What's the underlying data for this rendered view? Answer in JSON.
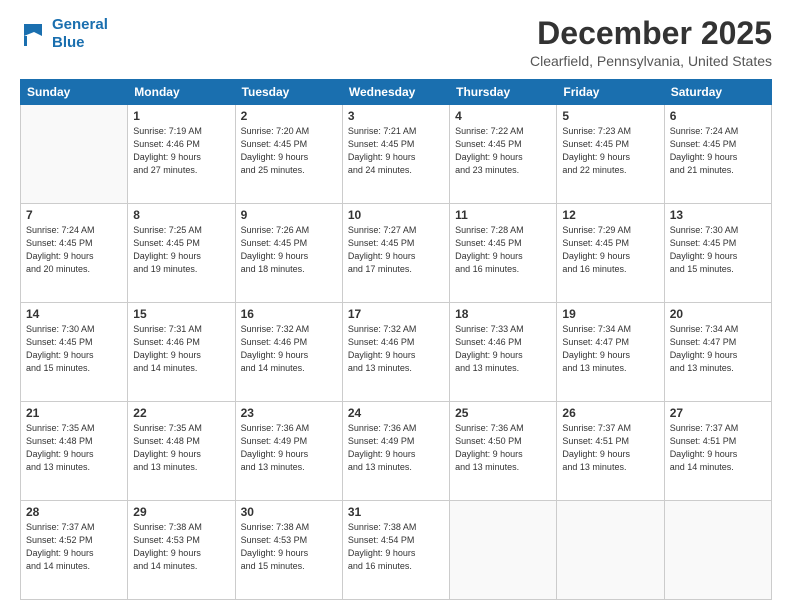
{
  "header": {
    "logo_line1": "General",
    "logo_line2": "Blue",
    "month_title": "December 2025",
    "location": "Clearfield, Pennsylvania, United States"
  },
  "weekdays": [
    "Sunday",
    "Monday",
    "Tuesday",
    "Wednesday",
    "Thursday",
    "Friday",
    "Saturday"
  ],
  "weeks": [
    [
      {
        "day": "",
        "info": ""
      },
      {
        "day": "1",
        "info": "Sunrise: 7:19 AM\nSunset: 4:46 PM\nDaylight: 9 hours\nand 27 minutes."
      },
      {
        "day": "2",
        "info": "Sunrise: 7:20 AM\nSunset: 4:45 PM\nDaylight: 9 hours\nand 25 minutes."
      },
      {
        "day": "3",
        "info": "Sunrise: 7:21 AM\nSunset: 4:45 PM\nDaylight: 9 hours\nand 24 minutes."
      },
      {
        "day": "4",
        "info": "Sunrise: 7:22 AM\nSunset: 4:45 PM\nDaylight: 9 hours\nand 23 minutes."
      },
      {
        "day": "5",
        "info": "Sunrise: 7:23 AM\nSunset: 4:45 PM\nDaylight: 9 hours\nand 22 minutes."
      },
      {
        "day": "6",
        "info": "Sunrise: 7:24 AM\nSunset: 4:45 PM\nDaylight: 9 hours\nand 21 minutes."
      }
    ],
    [
      {
        "day": "7",
        "info": "Sunrise: 7:24 AM\nSunset: 4:45 PM\nDaylight: 9 hours\nand 20 minutes."
      },
      {
        "day": "8",
        "info": "Sunrise: 7:25 AM\nSunset: 4:45 PM\nDaylight: 9 hours\nand 19 minutes."
      },
      {
        "day": "9",
        "info": "Sunrise: 7:26 AM\nSunset: 4:45 PM\nDaylight: 9 hours\nand 18 minutes."
      },
      {
        "day": "10",
        "info": "Sunrise: 7:27 AM\nSunset: 4:45 PM\nDaylight: 9 hours\nand 17 minutes."
      },
      {
        "day": "11",
        "info": "Sunrise: 7:28 AM\nSunset: 4:45 PM\nDaylight: 9 hours\nand 16 minutes."
      },
      {
        "day": "12",
        "info": "Sunrise: 7:29 AM\nSunset: 4:45 PM\nDaylight: 9 hours\nand 16 minutes."
      },
      {
        "day": "13",
        "info": "Sunrise: 7:30 AM\nSunset: 4:45 PM\nDaylight: 9 hours\nand 15 minutes."
      }
    ],
    [
      {
        "day": "14",
        "info": "Sunrise: 7:30 AM\nSunset: 4:45 PM\nDaylight: 9 hours\nand 15 minutes."
      },
      {
        "day": "15",
        "info": "Sunrise: 7:31 AM\nSunset: 4:46 PM\nDaylight: 9 hours\nand 14 minutes."
      },
      {
        "day": "16",
        "info": "Sunrise: 7:32 AM\nSunset: 4:46 PM\nDaylight: 9 hours\nand 14 minutes."
      },
      {
        "day": "17",
        "info": "Sunrise: 7:32 AM\nSunset: 4:46 PM\nDaylight: 9 hours\nand 13 minutes."
      },
      {
        "day": "18",
        "info": "Sunrise: 7:33 AM\nSunset: 4:46 PM\nDaylight: 9 hours\nand 13 minutes."
      },
      {
        "day": "19",
        "info": "Sunrise: 7:34 AM\nSunset: 4:47 PM\nDaylight: 9 hours\nand 13 minutes."
      },
      {
        "day": "20",
        "info": "Sunrise: 7:34 AM\nSunset: 4:47 PM\nDaylight: 9 hours\nand 13 minutes."
      }
    ],
    [
      {
        "day": "21",
        "info": "Sunrise: 7:35 AM\nSunset: 4:48 PM\nDaylight: 9 hours\nand 13 minutes."
      },
      {
        "day": "22",
        "info": "Sunrise: 7:35 AM\nSunset: 4:48 PM\nDaylight: 9 hours\nand 13 minutes."
      },
      {
        "day": "23",
        "info": "Sunrise: 7:36 AM\nSunset: 4:49 PM\nDaylight: 9 hours\nand 13 minutes."
      },
      {
        "day": "24",
        "info": "Sunrise: 7:36 AM\nSunset: 4:49 PM\nDaylight: 9 hours\nand 13 minutes."
      },
      {
        "day": "25",
        "info": "Sunrise: 7:36 AM\nSunset: 4:50 PM\nDaylight: 9 hours\nand 13 minutes."
      },
      {
        "day": "26",
        "info": "Sunrise: 7:37 AM\nSunset: 4:51 PM\nDaylight: 9 hours\nand 13 minutes."
      },
      {
        "day": "27",
        "info": "Sunrise: 7:37 AM\nSunset: 4:51 PM\nDaylight: 9 hours\nand 14 minutes."
      }
    ],
    [
      {
        "day": "28",
        "info": "Sunrise: 7:37 AM\nSunset: 4:52 PM\nDaylight: 9 hours\nand 14 minutes."
      },
      {
        "day": "29",
        "info": "Sunrise: 7:38 AM\nSunset: 4:53 PM\nDaylight: 9 hours\nand 14 minutes."
      },
      {
        "day": "30",
        "info": "Sunrise: 7:38 AM\nSunset: 4:53 PM\nDaylight: 9 hours\nand 15 minutes."
      },
      {
        "day": "31",
        "info": "Sunrise: 7:38 AM\nSunset: 4:54 PM\nDaylight: 9 hours\nand 16 minutes."
      },
      {
        "day": "",
        "info": ""
      },
      {
        "day": "",
        "info": ""
      },
      {
        "day": "",
        "info": ""
      }
    ]
  ]
}
